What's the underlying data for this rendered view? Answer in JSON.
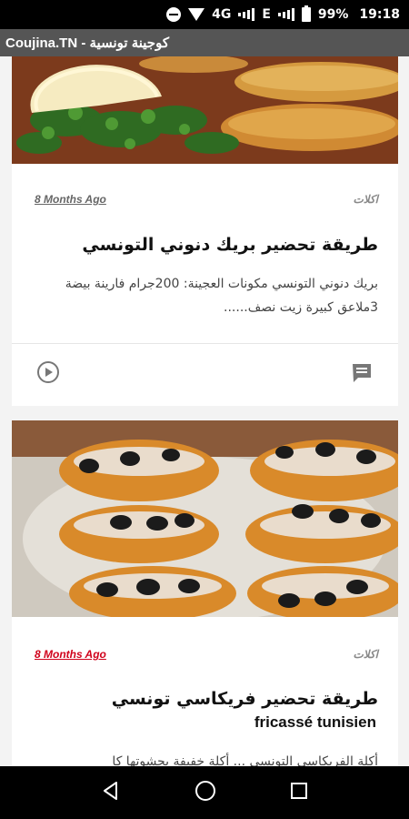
{
  "status_bar": {
    "network_type": "4G",
    "data_label": "E",
    "battery": "99%",
    "time": "19:18"
  },
  "app_bar": {
    "title": "Coujina.TN - كوجينة تونسية"
  },
  "articles": [
    {
      "image_alt": "brik-danouni-photo",
      "date": "8 Months Ago",
      "category": "اكلات",
      "title": "طريقة تحضير بريك دنوني التونسي",
      "excerpt": "بريك دنوني التونسي مكونات العجينة: 200جرام فارينة بيضة 3ملاعق كبيرة زيت نصف......",
      "actions": [
        "play-icon",
        "comment-icon"
      ]
    },
    {
      "image_alt": "fricasse-photo",
      "date": "8 Months Ago",
      "category": "اكلات",
      "title": "طريقة تحضير فريكاسي تونسي",
      "subtitle": "fricassé tunisien",
      "excerpt": "أكلة الفريكاسي التونسي ... أكلة خفيفة بحشوتها كا"
    }
  ],
  "colors": {
    "status_bar": "#000000",
    "app_bar": "#555555",
    "date_highlight": "#d0021b"
  }
}
